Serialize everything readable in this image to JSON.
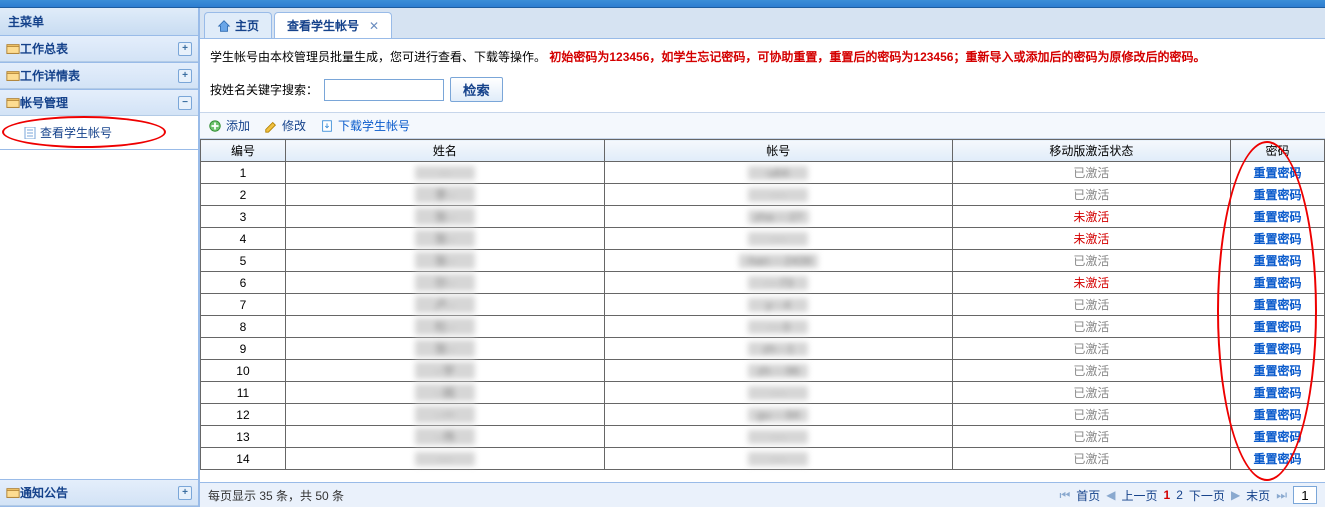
{
  "sidebar": {
    "title": "主菜单",
    "panels": [
      {
        "label": "工作总表",
        "tool": "+"
      },
      {
        "label": "工作详情表",
        "tool": "+"
      },
      {
        "label": "帐号管理",
        "tool": "−",
        "expanded": true,
        "items": [
          {
            "label": "查看学生帐号"
          }
        ]
      }
    ],
    "bottom_panel": {
      "label": "通知公告",
      "tool": "+"
    }
  },
  "tabs": [
    {
      "label": "主页",
      "home": true,
      "closable": false
    },
    {
      "label": "查看学生帐号",
      "closable": true,
      "active": true
    }
  ],
  "notice": {
    "text1": "学生帐号由本校管理员批量生成，您可进行查看、下载等操作。",
    "warn": "初始密码为123456，如学生忘记密码，可协助重置，重置后的密码为123456；重新导入或添加后的密码为原修改后的密码。"
  },
  "search": {
    "label": "按姓名关键字搜索：",
    "btn": "检索"
  },
  "toolbar": {
    "add": "添加",
    "edit": "修改",
    "download": "下载学生帐号"
  },
  "columns": [
    "编号",
    "姓名",
    "帐号",
    "移动版激活状态",
    "密码"
  ],
  "reset_label": "重置密码",
  "status": {
    "active": "已激活",
    "inactive": "未激活"
  },
  "rows": [
    {
      "no": "1",
      "name": "···",
      "acct": "·u64·",
      "status": "active"
    },
    {
      "no": "2",
      "name": "李··",
      "acct": "····",
      "status": "active"
    },
    {
      "no": "3",
      "name": "张··",
      "acct": "zha····27",
      "status": "inactive"
    },
    {
      "no": "4",
      "name": "张··",
      "acct": "····",
      "status": "inactive"
    },
    {
      "no": "5",
      "name": "张··",
      "acct": "·han····2439",
      "status": "active"
    },
    {
      "no": "6",
      "name": "尔··",
      "acct": "····73",
      "status": "inactive"
    },
    {
      "no": "7",
      "name": "卢··",
      "acct": "y···4",
      "status": "active"
    },
    {
      "no": "8",
      "name": "杜··",
      "acct": "····3",
      "status": "active"
    },
    {
      "no": "9",
      "name": "张··",
      "acct": "zh···1",
      "status": "active"
    },
    {
      "no": "10",
      "name": "··宇",
      "acct": "zh····96",
      "status": "active"
    },
    {
      "no": "11",
      "name": "··嫣",
      "acct": "····",
      "status": "active"
    },
    {
      "no": "12",
      "name": "··一",
      "acct": "gu····84",
      "status": "active"
    },
    {
      "no": "13",
      "name": "··伟",
      "acct": "····",
      "status": "active"
    },
    {
      "no": "14",
      "name": "····",
      "acct": "····",
      "status": "active"
    }
  ],
  "pager": {
    "left": "每页显示  35 条，共 50 条",
    "first": "首页",
    "prev": "上一页",
    "cur": "1",
    "p2": "2",
    "next": "下一页",
    "last": "末页",
    "goto_input": "1"
  }
}
